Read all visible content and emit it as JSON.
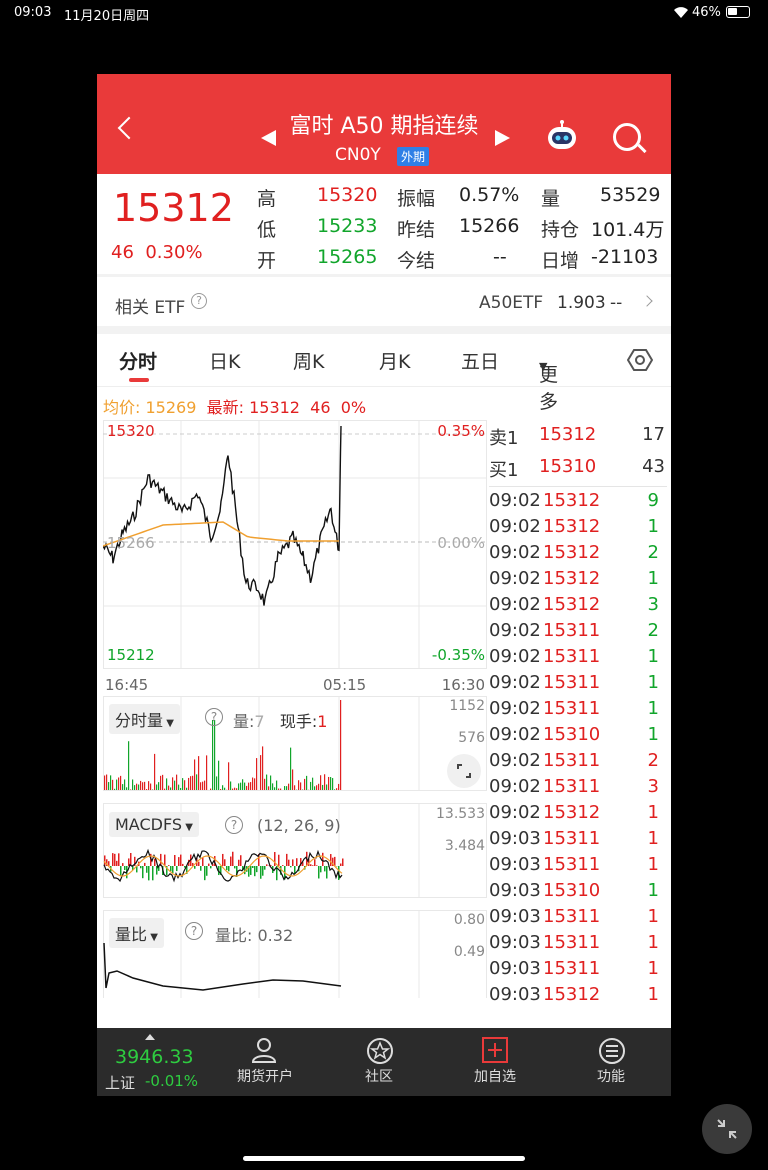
{
  "status_bar": {
    "time": "09:03",
    "date": "11月20日周四",
    "battery": "46%"
  },
  "header": {
    "title": "富时 A50 期指连续",
    "code": "CN0Y",
    "badge": "外期"
  },
  "quote": {
    "price": "15312",
    "change": "46",
    "change_pct": "0.30%",
    "fields": {
      "high_label": "高",
      "high": "15320",
      "low_label": "低",
      "low": "15233",
      "open_label": "开",
      "open": "15265",
      "amp_label": "振幅",
      "amp": "0.57%",
      "prev_label": "昨结",
      "prev": "15266",
      "today_label": "今结",
      "today": "--",
      "vol_label": "量",
      "vol": "53529",
      "oi_label": "持仓",
      "oi": "101.4万",
      "dayinc_label": "日增",
      "dayinc": "-21103"
    }
  },
  "etf": {
    "label": "相关 ETF",
    "name": "A50ETF",
    "price": "1.903",
    "change": "--"
  },
  "tabs": [
    "分时",
    "日K",
    "周K",
    "月K",
    "五日",
    "更多"
  ],
  "avg_line": {
    "avg_label": "均价:",
    "avg": "15269",
    "latest_label": "最新:",
    "latest": "15312",
    "chg": "46",
    "pct": "0%"
  },
  "chart": {
    "top_price": "15320",
    "top_pct": "0.35%",
    "mid_price": "15266",
    "mid_pct": "0.00%",
    "bottom_price": "15212",
    "bottom_pct": "-0.35%",
    "time_start": "16:45",
    "time_mid": "05:15",
    "time_end": "16:30"
  },
  "volume_panel": {
    "label": "分时量",
    "q_label": "量:",
    "q_value": "7",
    "now_label": "现手:",
    "now_value": "1",
    "axis_top": "1152",
    "axis_mid": "576"
  },
  "macd_panel": {
    "label": "MACDFS",
    "params": "(12, 26, 9)",
    "axis_top": "13.533",
    "axis_mid": "3.484"
  },
  "ratio_panel": {
    "label": "量比",
    "ratio_label": "量比:",
    "ratio_value": "0.32",
    "axis_top": "0.80",
    "axis_mid": "0.49"
  },
  "orderbook": {
    "ask_label": "卖1",
    "ask_price": "15312",
    "ask_vol": "17",
    "bid_label": "买1",
    "bid_price": "15310",
    "bid_vol": "43"
  },
  "trades": [
    {
      "t": "09:02",
      "p": "15312",
      "v": "9",
      "vc": "green"
    },
    {
      "t": "09:02",
      "p": "15312",
      "v": "1",
      "vc": "green"
    },
    {
      "t": "09:02",
      "p": "15312",
      "v": "2",
      "vc": "green"
    },
    {
      "t": "09:02",
      "p": "15312",
      "v": "1",
      "vc": "green"
    },
    {
      "t": "09:02",
      "p": "15312",
      "v": "3",
      "vc": "green"
    },
    {
      "t": "09:02",
      "p": "15311",
      "v": "2",
      "vc": "green"
    },
    {
      "t": "09:02",
      "p": "15311",
      "v": "1",
      "vc": "green"
    },
    {
      "t": "09:02",
      "p": "15311",
      "v": "1",
      "vc": "green"
    },
    {
      "t": "09:02",
      "p": "15311",
      "v": "1",
      "vc": "green"
    },
    {
      "t": "09:02",
      "p": "15310",
      "v": "1",
      "vc": "green"
    },
    {
      "t": "09:02",
      "p": "15311",
      "v": "2",
      "vc": "red"
    },
    {
      "t": "09:02",
      "p": "15311",
      "v": "3",
      "vc": "red"
    },
    {
      "t": "09:02",
      "p": "15312",
      "v": "1",
      "vc": "red"
    },
    {
      "t": "09:03",
      "p": "15311",
      "v": "1",
      "vc": "red"
    },
    {
      "t": "09:03",
      "p": "15311",
      "v": "1",
      "vc": "red"
    },
    {
      "t": "09:03",
      "p": "15310",
      "v": "1",
      "vc": "green"
    },
    {
      "t": "09:03",
      "p": "15311",
      "v": "1",
      "vc": "red"
    },
    {
      "t": "09:03",
      "p": "15311",
      "v": "1",
      "vc": "red"
    },
    {
      "t": "09:03",
      "p": "15311",
      "v": "1",
      "vc": "red"
    },
    {
      "t": "09:03",
      "p": "15312",
      "v": "1",
      "vc": "red"
    }
  ],
  "bottom_nav": {
    "index_value": "3946.33",
    "index_name": "上证",
    "index_chg": "-0.01%",
    "items": [
      "期货开户",
      "社区",
      "加自选",
      "功能"
    ]
  },
  "colors": {
    "red": "#e02020",
    "green": "#11a52b",
    "header": "#e93a3a",
    "avg": "#f0a030"
  }
}
